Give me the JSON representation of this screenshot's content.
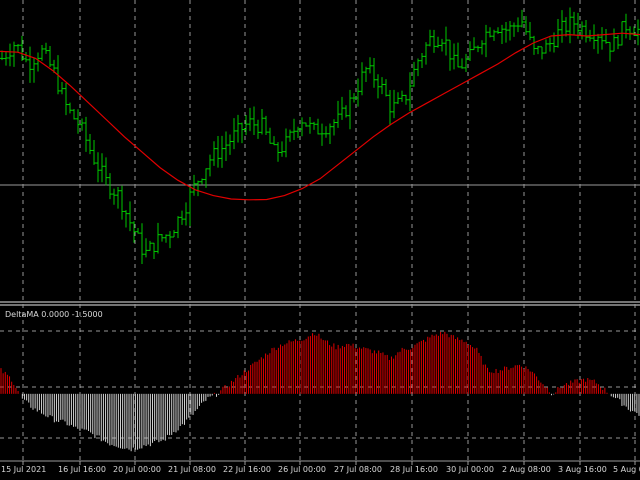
{
  "colors": {
    "background": "#000000",
    "grid": "#c8c8c8",
    "price_bar": "#00c800",
    "moving_average": "#e00000",
    "histogram_positive": "#e00000",
    "histogram_negative": "#d0d0d0",
    "separator": "#9a9a9a",
    "text": "#d8d8d8"
  },
  "chart_data": [
    {
      "type": "ohlc",
      "grid": true,
      "horizontal_level": "at current price",
      "series": [
        {
          "kind": "price-bars"
        },
        {
          "kind": "moving-average",
          "values": [
            0.845,
            0.842,
            0.82,
            0.775,
            0.72,
            0.66,
            0.6,
            0.54,
            0.485,
            0.43,
            0.385,
            0.35,
            0.33,
            0.318,
            0.315,
            0.316,
            0.33,
            0.355,
            0.39,
            0.44,
            0.49,
            0.54,
            0.585,
            0.625,
            0.66,
            0.695,
            0.73,
            0.765,
            0.8,
            0.84,
            0.875,
            0.9,
            0.905,
            0.9,
            0.905,
            0.91,
            0.905
          ]
        }
      ],
      "close_values": [
        0.82,
        0.875,
        0.8,
        0.85,
        0.77,
        0.64,
        0.58,
        0.47,
        0.38,
        0.33,
        0.22,
        0.12,
        0.17,
        0.2,
        0.28,
        0.38,
        0.46,
        0.5,
        0.55,
        0.59,
        0.58,
        0.48,
        0.52,
        0.61,
        0.56,
        0.58,
        0.6,
        0.68,
        0.78,
        0.74,
        0.64,
        0.67,
        0.81,
        0.89,
        0.9,
        0.78,
        0.82,
        0.9,
        0.94,
        0.92,
        0.96,
        0.84,
        0.86,
        0.92,
        0.95,
        0.92,
        0.91,
        0.86,
        0.94,
        0.92
      ],
      "x_tick_labels": [
        "15 Jul 2021",
        "16 Jul 16:00",
        "20 Jul 00:00",
        "21 Jul 08:00",
        "22 Jul 16:00",
        "26 Jul 00:00",
        "27 Jul 08:00",
        "28 Jul 16:00",
        "30 Jul 00:00",
        "2 Aug 08:00",
        "3 Aug 16:00",
        "5 Aug 00:00"
      ]
    },
    {
      "type": "histogram",
      "title": "DeltaMA 0.0000 -1.5000",
      "grid": true,
      "ylim": [
        -2.2,
        2.6
      ],
      "values": [
        0.8,
        0.5,
        -0.2,
        -0.5,
        -0.7,
        -0.9,
        -1.0,
        -1.2,
        -1.3,
        -1.5,
        -1.7,
        -1.8,
        -1.9,
        -1.8,
        -1.7,
        -1.6,
        -1.3,
        -1.0,
        -0.6,
        -0.2,
        0.0,
        0.3,
        0.6,
        0.9,
        1.2,
        1.5,
        1.7,
        1.8,
        1.9,
        2.1,
        1.8,
        1.6,
        1.7,
        1.6,
        1.5,
        1.4,
        1.2,
        1.5,
        1.6,
        1.8,
        2.0,
        2.1,
        1.9,
        1.8,
        1.5,
        0.8,
        0.8,
        0.9,
        1.0,
        0.8,
        0.4,
        0.0,
        0.3,
        0.4,
        0.5,
        0.4,
        0.1,
        -0.2,
        -0.5,
        -0.7
      ]
    }
  ]
}
